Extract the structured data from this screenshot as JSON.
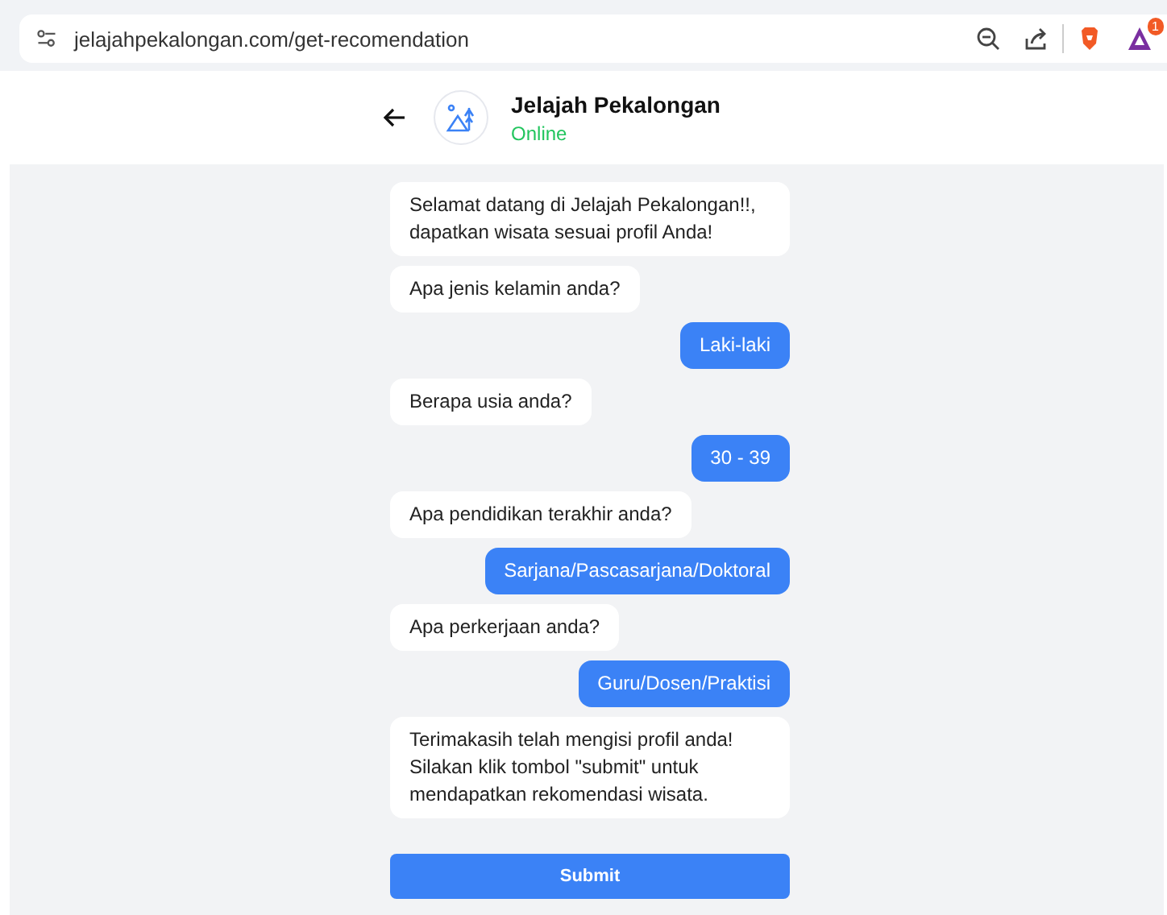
{
  "browser": {
    "url": "jelajahpekalongan.com/get-recomendation",
    "badge": "1"
  },
  "header": {
    "title": "Jelajah Pekalongan",
    "status": "Online"
  },
  "messages": [
    {
      "kind": "bot",
      "text": "Selamat datang di Jelajah Pekalongan!!, dapatkan wisata sesuai profil Anda!"
    },
    {
      "kind": "bot",
      "text": "Apa jenis kelamin anda?"
    },
    {
      "kind": "user",
      "text": "Laki-laki"
    },
    {
      "kind": "bot",
      "text": "Berapa usia anda?"
    },
    {
      "kind": "user",
      "text": "30 - 39"
    },
    {
      "kind": "bot",
      "text": "Apa pendidikan terakhir anda?"
    },
    {
      "kind": "user",
      "text": "Sarjana/Pascasarjana/Doktoral"
    },
    {
      "kind": "bot",
      "text": "Apa perkerjaan anda?"
    },
    {
      "kind": "user",
      "text": "Guru/Dosen/Praktisi"
    },
    {
      "kind": "bot",
      "text": "Terimakasih telah mengisi profil anda! Silakan klik tombol \"submit\" untuk mendapatkan rekomendasi wisata."
    }
  ],
  "submit": "Submit"
}
